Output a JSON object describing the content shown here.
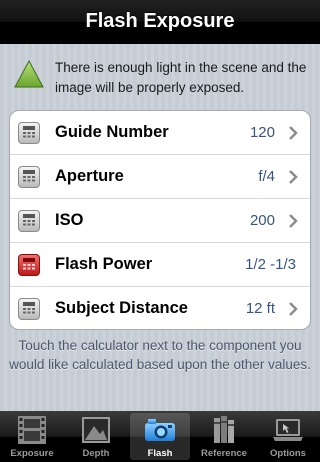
{
  "header": {
    "title": "Flash Exposure"
  },
  "status": {
    "icon": "green-triangle-icon",
    "color": "#8cc84b",
    "message": "There is enough light in the scene and the image will be properly exposed."
  },
  "rows": [
    {
      "label": "Guide Number",
      "value": "120",
      "icon": "calculator-icon",
      "highlight": false
    },
    {
      "label": "Aperture",
      "value": "f/4",
      "icon": "calculator-icon",
      "highlight": false
    },
    {
      "label": "ISO",
      "value": "200",
      "icon": "calculator-icon",
      "highlight": false
    },
    {
      "label": "Flash Power",
      "value": "1/2 -1/3",
      "icon": "calculator-icon",
      "highlight": true
    },
    {
      "label": "Subject Distance",
      "value": "12 ft",
      "icon": "calculator-icon",
      "highlight": false
    }
  ],
  "hint": "Touch the calculator next to the component you would like calculated based upon the other values.",
  "tabs": [
    {
      "label": "Exposure",
      "icon": "film-icon",
      "active": false
    },
    {
      "label": "Depth",
      "icon": "landscape-icon",
      "active": false
    },
    {
      "label": "Flash",
      "icon": "camera-icon",
      "active": true
    },
    {
      "label": "Reference",
      "icon": "books-icon",
      "active": false
    },
    {
      "label": "Options",
      "icon": "laptop-icon",
      "active": false
    }
  ],
  "colors": {
    "value_text": "#385487",
    "active_tab_icon": "#4aa3e8"
  }
}
